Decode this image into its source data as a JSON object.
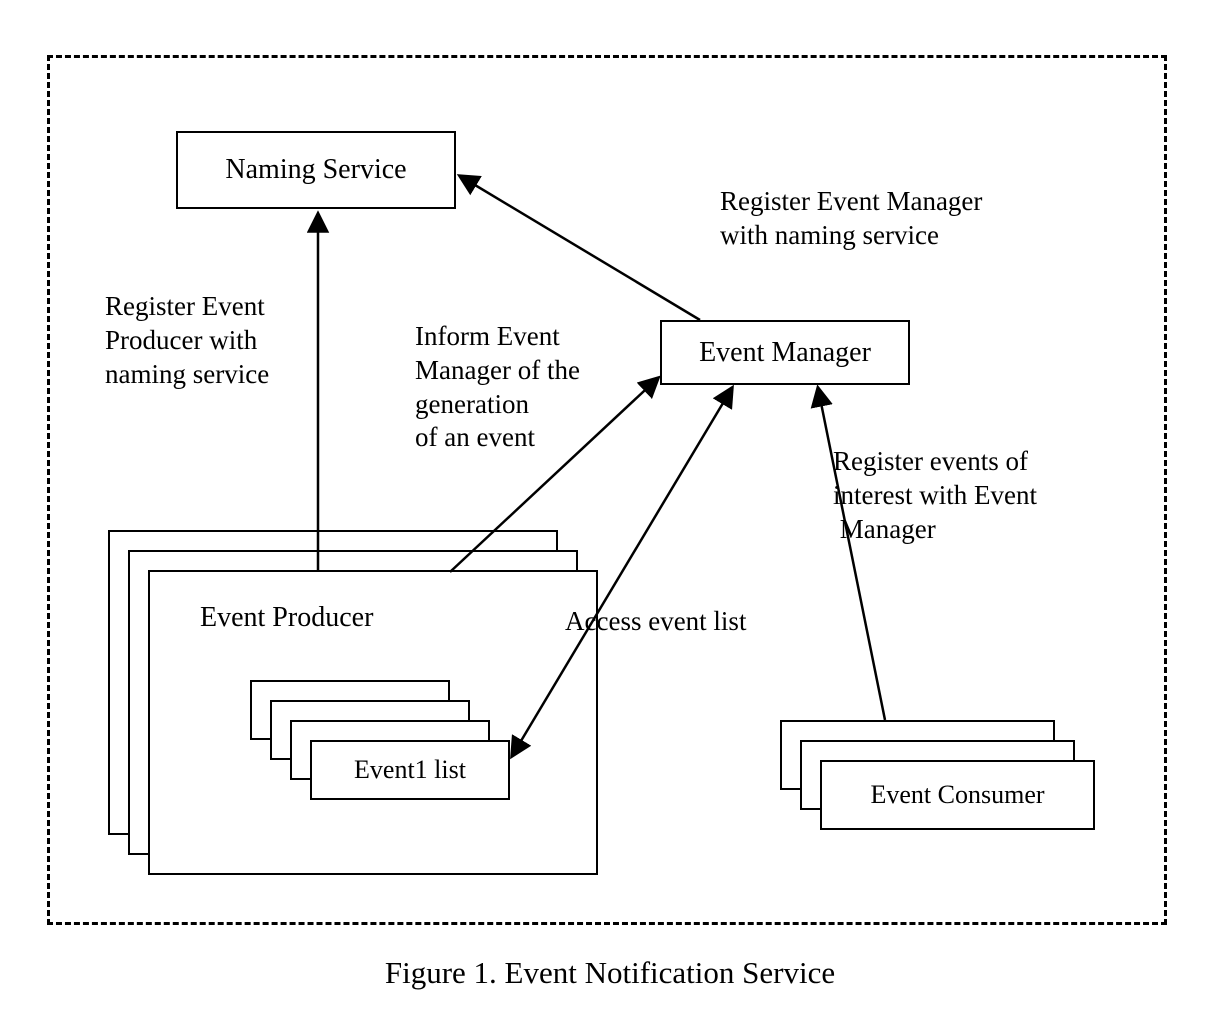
{
  "frame": {},
  "boxes": {
    "naming_service": "Naming Service",
    "event_manager": "Event Manager",
    "event_producer": "Event Producer",
    "event_list": "Event1 list",
    "event_consumer": "Event Consumer"
  },
  "labels": {
    "register_producer": "Register Event\nProducer with\nnaming service",
    "inform_manager": "Inform Event\nManager of the\ngeneration\nof an event",
    "register_manager": "Register Event Manager\nwith naming service",
    "access_list": "Access event list",
    "register_interest": "Register events of\ninterest with Event\n Manager"
  },
  "caption": "Figure 1. Event Notification Service"
}
